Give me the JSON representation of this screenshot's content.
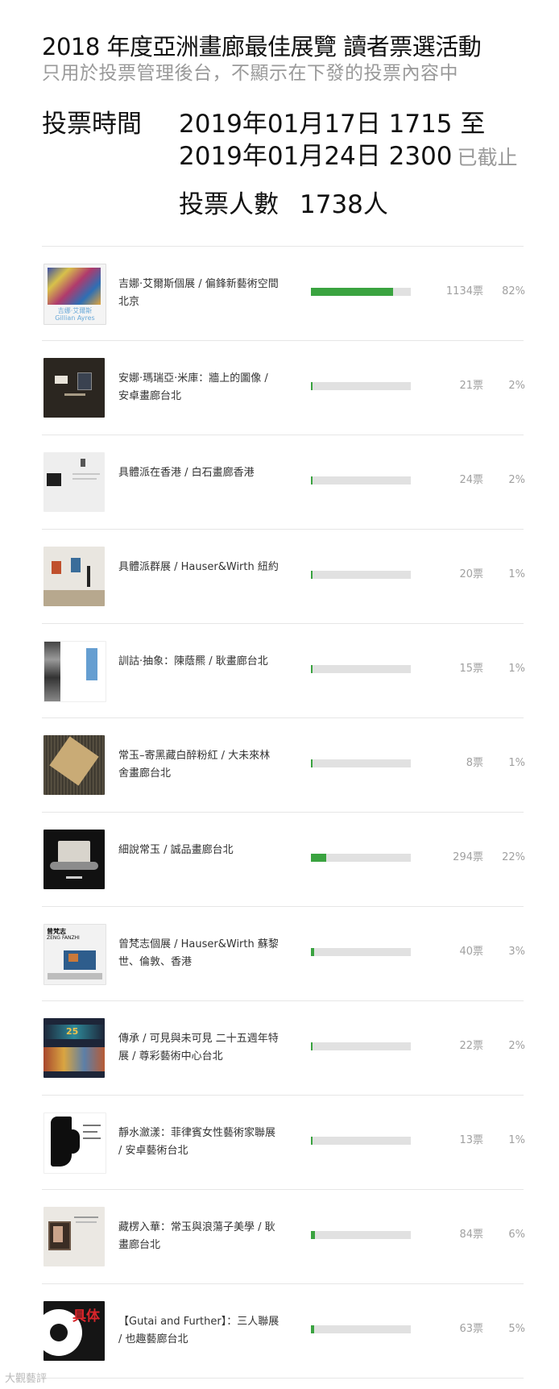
{
  "header": {
    "title": "2018 年度亞洲畫廊最佳展覽 讀者票選活動",
    "subtitle": "只用於投票管理後台，不顯示在下發的投票內容中"
  },
  "vote_time": {
    "label": "投票時間",
    "start": "2019年01月17日 1715 至",
    "end": "2019年01月24日 2300",
    "ended": "已截止"
  },
  "voters": {
    "label": "投票人數",
    "count": "1738人"
  },
  "items": [
    {
      "name": "吉娜·艾爾斯個展 / 偏鋒新藝術空間北京",
      "votes": "1134票",
      "pct": "82%",
      "share": 0.82
    },
    {
      "name": "安娜·瑪瑞亞·米庫：牆上的圖像 / 安卓畫廊台北",
      "votes": "21票",
      "pct": "2%",
      "share": 0.02
    },
    {
      "name": "具體派在香港 / 白石畫廊香港",
      "votes": "24票",
      "pct": "2%",
      "share": 0.02
    },
    {
      "name": "具體派群展 / Hauser&Wirth 紐約",
      "votes": "20票",
      "pct": "1%",
      "share": 0.01
    },
    {
      "name": "訓詁·抽象：陳蔭羆 / 耿畫廊台北",
      "votes": "15票",
      "pct": "1%",
      "share": 0.01
    },
    {
      "name": "常玉–寄黑藏白醉粉紅 / 大未來林舍畫廊台北",
      "votes": "8票",
      "pct": "1%",
      "share": 0.01
    },
    {
      "name": "細說常玉 / 誠品畫廊台北",
      "votes": "294票",
      "pct": "22%",
      "share": 0.15
    },
    {
      "name": "曾梵志個展 / Hauser&Wirth 蘇黎世、倫敦、香港",
      "votes": "40票",
      "pct": "3%",
      "share": 0.03
    },
    {
      "name": "傳承 / 可見與未可見 二十五週年特展 / 尊彩藝術中心台北",
      "votes": "22票",
      "pct": "2%",
      "share": 0.02
    },
    {
      "name": "靜水瀲漾：菲律賓女性藝術家聯展 / 安卓藝術台北",
      "votes": "13票",
      "pct": "1%",
      "share": 0.01
    },
    {
      "name": "藏楞入華：常玉與浪蕩子美學 / 耿畫廊台北",
      "votes": "84票",
      "pct": "6%",
      "share": 0.04
    },
    {
      "name": "【Gutai and Further】：三人聯展 / 也趣藝廊台北",
      "votes": "63票",
      "pct": "5%",
      "share": 0.03
    }
  ],
  "thumb_text": {
    "t1": "吉娜·艾爾斯",
    "t1b": "Gillian Ayres",
    "t8": "曾梵志",
    "t8b": "ZENG FANZHI",
    "t12": "具体"
  },
  "watermark": "大觀藝評",
  "colors": {
    "bar_fill": "#3aa340",
    "bar_track": "#e1e1e1",
    "muted_text": "#9a9a9a"
  }
}
